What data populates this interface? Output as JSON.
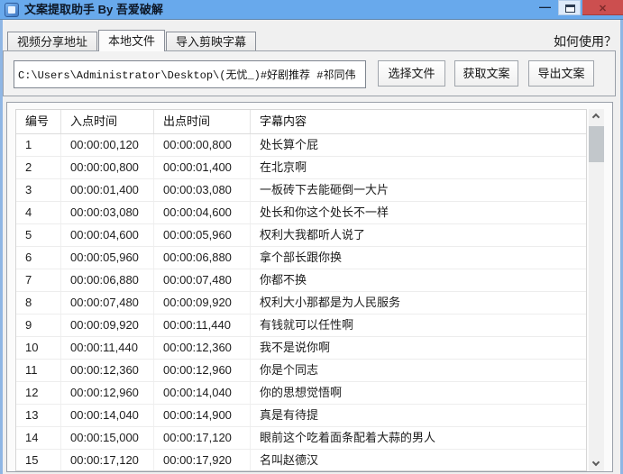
{
  "window": {
    "title": "文案提取助手 By 吾爱破解"
  },
  "titlebar": {
    "minimize_glyph": "—",
    "close_glyph": "✕"
  },
  "colors": {
    "titlebar": "#68a9ec",
    "close_button": "#cc4f4f"
  },
  "help_label": "如何使用？",
  "tabs": [
    {
      "label": "视频分享地址",
      "active": false
    },
    {
      "label": "本地文件",
      "active": true
    },
    {
      "label": "导入剪映字幕",
      "active": false
    }
  ],
  "file_input": {
    "value": "C:\\Users\\Administrator\\Desktop\\(无忧_)#好剧推荐 #祁同伟 #因为一个"
  },
  "buttons": {
    "select_file": "选择文件",
    "get_text": "获取文案",
    "export_text": "导出文案"
  },
  "table": {
    "headers": [
      "编号",
      "入点时间",
      "出点时间",
      "字幕内容"
    ],
    "rows": [
      [
        "1",
        "00:00:00,120",
        "00:00:00,800",
        "处长算个屁"
      ],
      [
        "2",
        "00:00:00,800",
        "00:00:01,400",
        "在北京啊"
      ],
      [
        "3",
        "00:00:01,400",
        "00:00:03,080",
        "一板砖下去能砸倒一大片"
      ],
      [
        "4",
        "00:00:03,080",
        "00:00:04,600",
        "处长和你这个处长不一样"
      ],
      [
        "5",
        "00:00:04,600",
        "00:00:05,960",
        "权利大我都听人说了"
      ],
      [
        "6",
        "00:00:05,960",
        "00:00:06,880",
        "拿个部长跟你换"
      ],
      [
        "7",
        "00:00:06,880",
        "00:00:07,480",
        "你都不换"
      ],
      [
        "8",
        "00:00:07,480",
        "00:00:09,920",
        "权利大小那都是为人民服务"
      ],
      [
        "9",
        "00:00:09,920",
        "00:00:11,440",
        "有钱就可以任性啊"
      ],
      [
        "10",
        "00:00:11,440",
        "00:00:12,360",
        "我不是说你啊"
      ],
      [
        "11",
        "00:00:12,360",
        "00:00:12,960",
        "你是个同志"
      ],
      [
        "12",
        "00:00:12,960",
        "00:00:14,040",
        "你的思想觉悟啊"
      ],
      [
        "13",
        "00:00:14,040",
        "00:00:14,900",
        "真是有待提"
      ],
      [
        "14",
        "00:00:15,000",
        "00:00:17,120",
        "眼前这个吃着面条配着大蒜的男人"
      ],
      [
        "15",
        "00:00:17,120",
        "00:00:17,920",
        "名叫赵德汉"
      ]
    ]
  }
}
